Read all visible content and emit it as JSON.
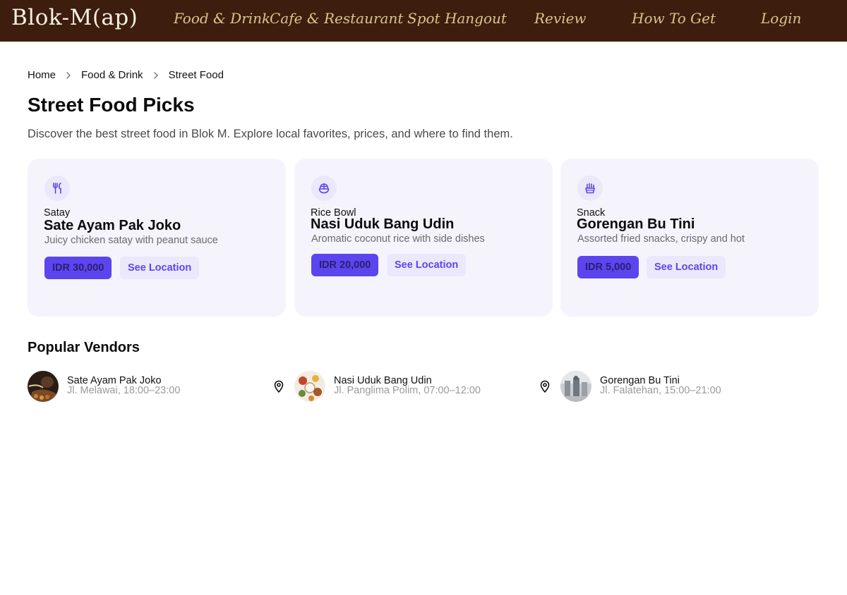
{
  "nav": {
    "brand": "Blok-M(ap)",
    "links": [
      "Food & Drink",
      "Cafe & Restaurant",
      "Spot Hangout",
      "Review",
      "How To Get",
      "Login"
    ]
  },
  "breadcrumb": [
    "Home",
    "Food & Drink",
    "Street Food"
  ],
  "page": {
    "title": "Street Food Picks",
    "description": "Discover the best street food in Blok M. Explore local favorites, prices, and where to find them."
  },
  "cards": [
    {
      "icon": "utensils-icon",
      "category": "Satay",
      "name": "Sate Ayam Pak Joko",
      "description": "Juicy chicken satay with peanut sauce",
      "price": "IDR 30,000",
      "action": "See Location"
    },
    {
      "icon": "rice-bowl-icon",
      "category": "Rice Bowl",
      "name": "Nasi Uduk Bang Udin",
      "description": "Aromatic coconut rice with side dishes",
      "price": "IDR 20,000",
      "action": "See Location"
    },
    {
      "icon": "fries-icon",
      "category": "Snack",
      "name": "Gorengan Bu Tini",
      "description": "Assorted fried snacks, crispy and hot",
      "price": "IDR 5,000",
      "action": "See Location"
    }
  ],
  "vendors_section": {
    "title": "Popular Vendors",
    "items": [
      {
        "name": "Sate Ayam Pak Joko",
        "info": "Jl. Melawai, 18:00–23:00"
      },
      {
        "name": "Nasi Uduk Bang Udin",
        "info": "Jl. Panglima Polim, 07:00–12:00"
      },
      {
        "name": "Gorengan Bu Tini",
        "info": "Jl. Falatehan, 15:00–21:00"
      }
    ]
  },
  "colors": {
    "navbar": "#3d1d0d",
    "brand": "#f5f0e4",
    "nav_link": "#d9c68e",
    "accent": "#5b45ef",
    "card_bg": "#f5f4fd"
  }
}
